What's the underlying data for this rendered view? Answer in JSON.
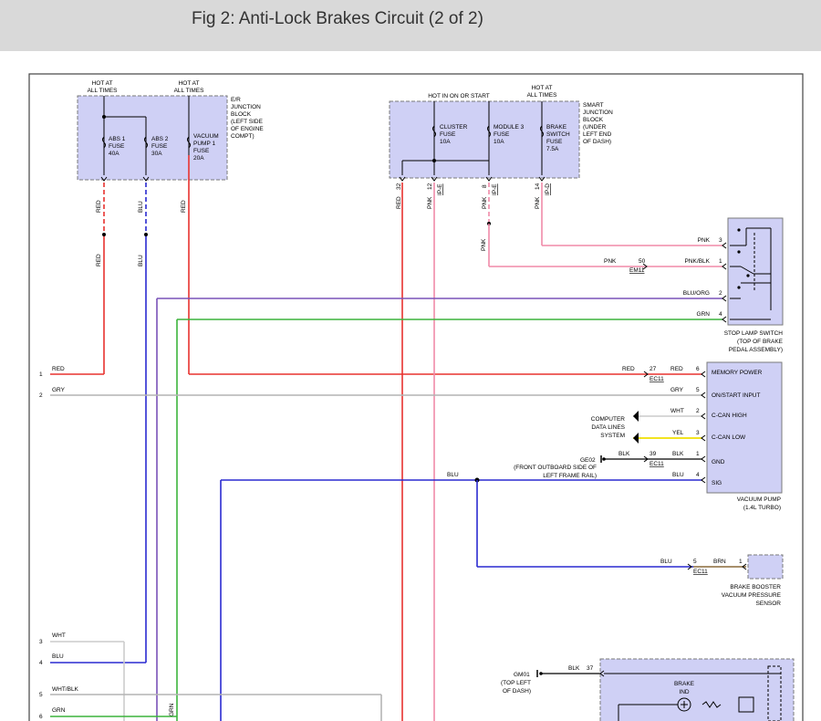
{
  "title": "Fig 2: Anti-Lock Brakes Circuit (2 of 2)",
  "colors": {
    "red": "#e8322f",
    "pink": "#f08aa8",
    "blue": "#2a2ad0",
    "purple": "#7a52b8",
    "green": "#3cb43c",
    "gray": "#b4b4b4",
    "yellow": "#f0e000",
    "brown": "#8a6a3a",
    "box_fill": "#cfd0f5",
    "box_border": "#7a7a7a"
  },
  "er_box": {
    "hot_a": [
      "HOT AT",
      "ALL TIMES"
    ],
    "hot_b": [
      "HOT AT",
      "ALL TIMES"
    ],
    "name": [
      "E/R",
      "JUNCTION",
      "BLOCK",
      "(LEFT SIDE",
      "OF ENGINE",
      "COMPT)"
    ],
    "fuse1": [
      "ABS 1",
      "FUSE",
      "40A"
    ],
    "fuse2": [
      "ABS 2",
      "FUSE",
      "30A"
    ],
    "fuse3": [
      "VACUUM",
      "PUMP 1",
      "FUSE",
      "20A"
    ]
  },
  "sjb_box": {
    "hot_run": "HOT IN ON OR START",
    "hot_all": [
      "HOT AT",
      "ALL TIMES"
    ],
    "name": [
      "SMART",
      "JUNCTION",
      "BLOCK",
      "(UNDER",
      "LEFT END",
      "OF DASH)"
    ],
    "fuse1": [
      "CLUSTER",
      "FUSE",
      "10A"
    ],
    "fuse2": [
      "MODULE 3",
      "FUSE",
      "10A"
    ],
    "fuse3": [
      "BRAKE",
      "SWITCH",
      "FUSE",
      "7.5A"
    ],
    "pins": [
      {
        "wire": "RED",
        "pin": "32",
        "conn": ""
      },
      {
        "wire": "PNK",
        "pin": "12",
        "conn": "IP-E"
      },
      {
        "wire": "PNK",
        "pin": "8",
        "conn": "IP-E"
      },
      {
        "wire": "PNK",
        "pin": "14",
        "conn": "IP-D"
      }
    ]
  },
  "wire_labels": {
    "red": "RED",
    "blu": "BLU",
    "pnk": "PNK",
    "pnk_blk": "PNK/BLK",
    "blu_org": "BLU/ORG",
    "grn": "GRN",
    "gry": "GRY",
    "wht": "WHT",
    "yel": "YEL",
    "blk": "BLK",
    "brn": "BRN",
    "wht_blk": "WHT/BLK"
  },
  "stop_lamp": {
    "name": [
      "STOP LAMP SWITCH",
      "(TOP OF BRAKE",
      "PEDAL ASSEMBLY)"
    ],
    "pins": [
      "3",
      "1",
      "2",
      "4"
    ],
    "inline_pin": "50",
    "inline_conn": "EM11"
  },
  "vacuum_pump": {
    "name": [
      "VACUUM PUMP",
      "(1.4L TURBO)"
    ],
    "terms": [
      "MEMORY POWER",
      "ON/START INPUT",
      "C-CAN HIGH",
      "C-CAN LOW",
      "GND",
      "SIG"
    ],
    "pins": [
      "6",
      "5",
      "2",
      "3",
      "1",
      "4"
    ],
    "inline_pin_power": "27",
    "inline_pin_gnd": "39",
    "conn": "EC11"
  },
  "data_lines": [
    "COMPUTER",
    "DATA LINES",
    "SYSTEM"
  ],
  "ground1": {
    "id": "GE02",
    "desc": [
      "(FRONT OUTBOARD SIDE OF",
      "LEFT FRAME RAIL)"
    ]
  },
  "sensor": {
    "name": [
      "BRAKE BOOSTER",
      "VACUUM PRESSURE",
      "SENSOR"
    ],
    "pin": "1",
    "inline_pin": "5",
    "conn": "EC11"
  },
  "ground2": {
    "id": "GM01",
    "desc": [
      "(TOP LEFT",
      "OF DASH)"
    ],
    "pin": "37"
  },
  "cluster": {
    "label": [
      "BRAKE",
      "IND"
    ]
  },
  "left_refs": [
    "1",
    "2",
    "3",
    "4",
    "5",
    "6"
  ]
}
